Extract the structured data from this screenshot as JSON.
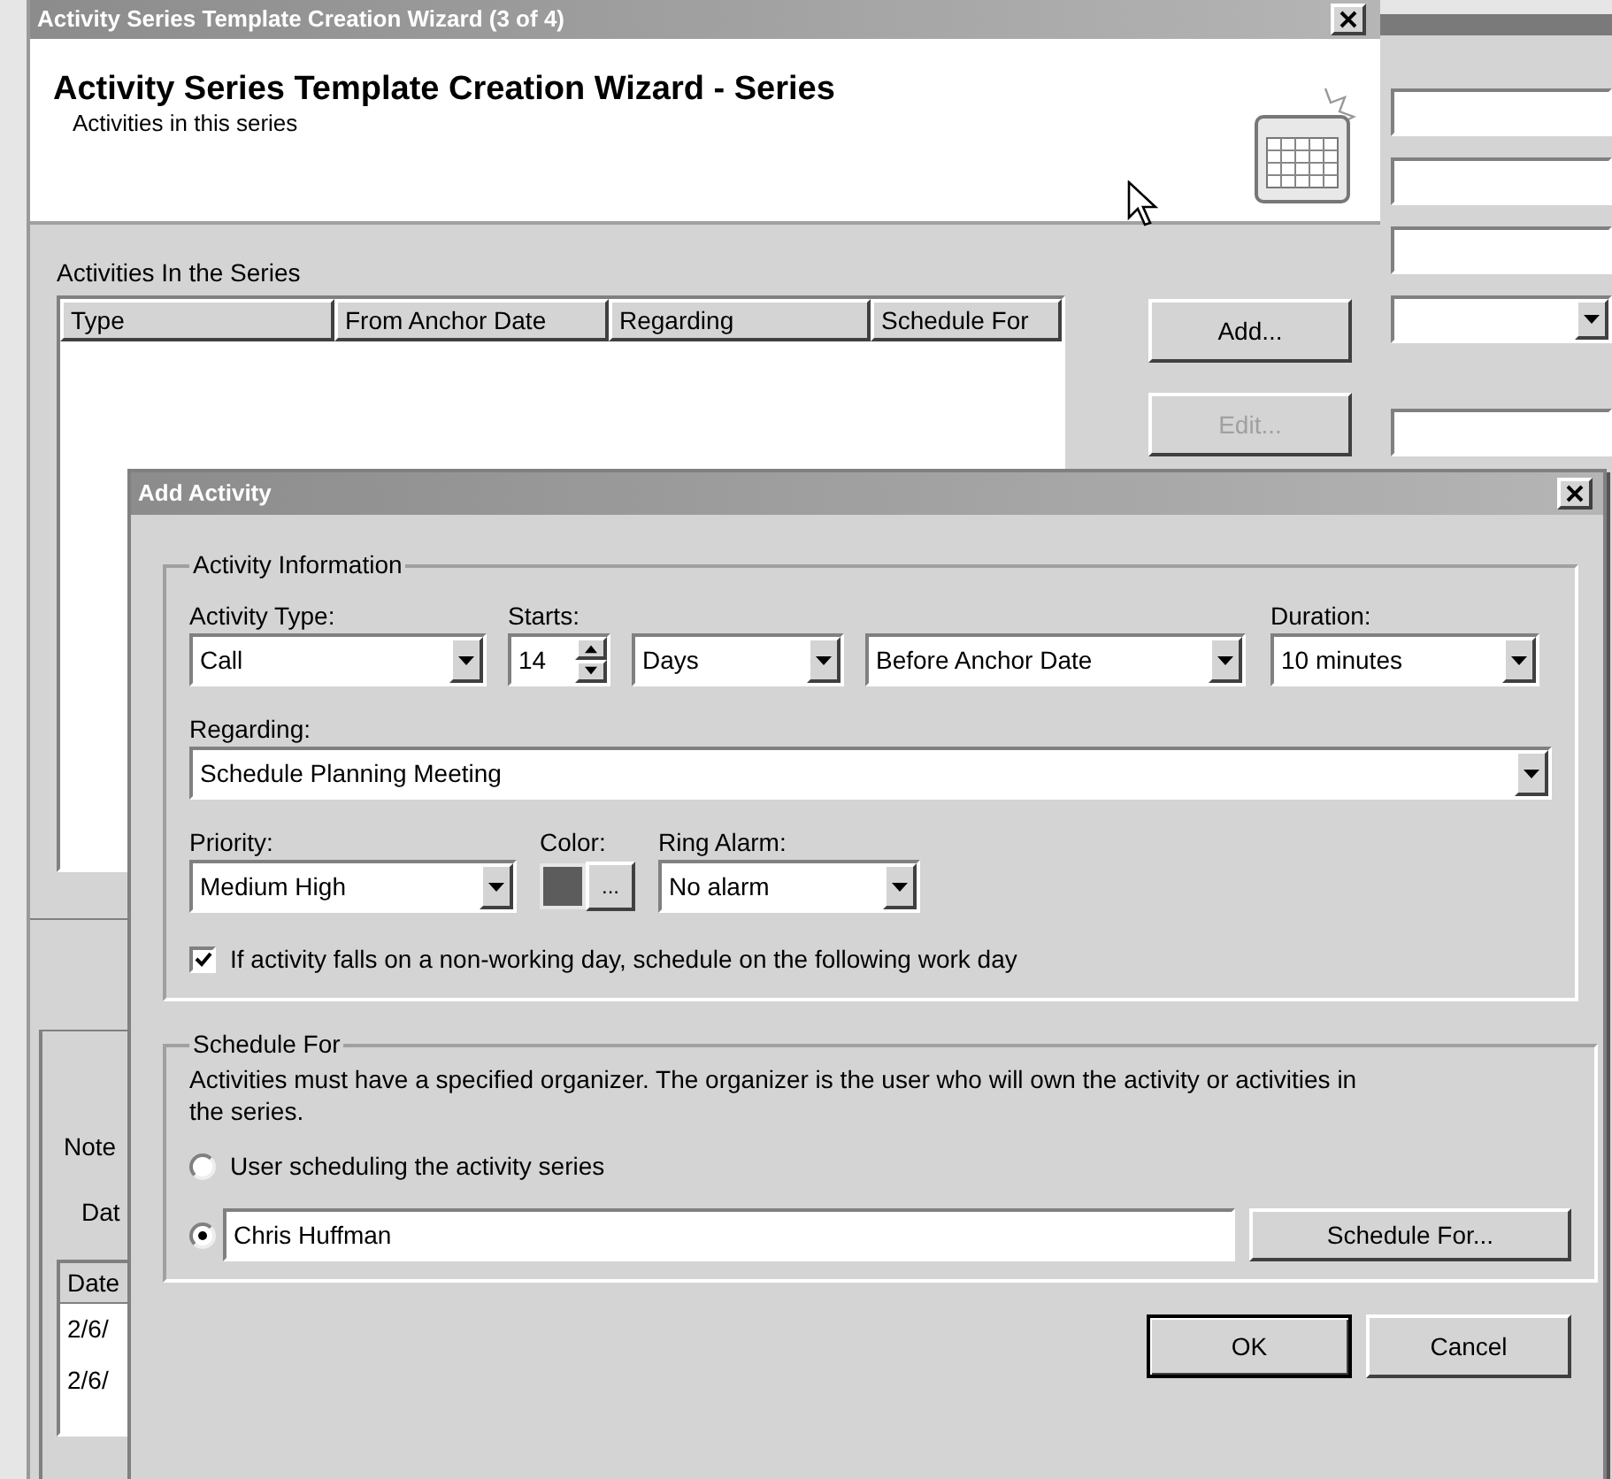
{
  "wizard": {
    "title": "Activity Series Template Creation Wizard (3 of 4)",
    "heading": "Activity Series Template Creation Wizard - Series",
    "subheading": "Activities in this series",
    "list_label": "Activities In the Series",
    "columns": [
      "Type",
      "From Anchor Date",
      "Regarding",
      "Schedule For"
    ],
    "buttons": [
      {
        "label": "Add...",
        "disabled": false
      },
      {
        "label": "Edit...",
        "disabled": true
      }
    ]
  },
  "background_panel": {
    "tab": "Note",
    "button": "Dat",
    "column": "Date",
    "rows": [
      "2/6/",
      "2/6/"
    ]
  },
  "dialog": {
    "title": "Add Activity",
    "activity_information": {
      "legend": "Activity Information",
      "activity_type": {
        "label": "Activity Type:",
        "value": "Call"
      },
      "starts": {
        "label": "Starts:",
        "value": "14",
        "unit": "Days",
        "relation": "Before Anchor Date"
      },
      "duration": {
        "label": "Duration:",
        "value": "10 minutes"
      },
      "regarding": {
        "label": "Regarding:",
        "value": "Schedule Planning Meeting"
      },
      "priority": {
        "label": "Priority:",
        "value": "Medium High"
      },
      "color": {
        "label": "Color:",
        "color": "#5c5c5c",
        "button": "..."
      },
      "ring_alarm": {
        "label": "Ring Alarm:",
        "value": "No alarm"
      },
      "non_working_day": {
        "label": "If activity falls on a non-working day, schedule on the following work day",
        "checked": true
      }
    },
    "schedule_for": {
      "legend": "Schedule For",
      "description": "Activities must have a specified organizer. The organizer is the user who will own the activity or activities in the series.",
      "options": [
        {
          "kind": "label",
          "label": "User scheduling the activity series",
          "selected": false
        },
        {
          "kind": "field",
          "value": "Chris Huffman",
          "selected": true
        }
      ],
      "button": "Schedule For..."
    },
    "buttons": [
      "OK",
      "Cancel"
    ]
  }
}
